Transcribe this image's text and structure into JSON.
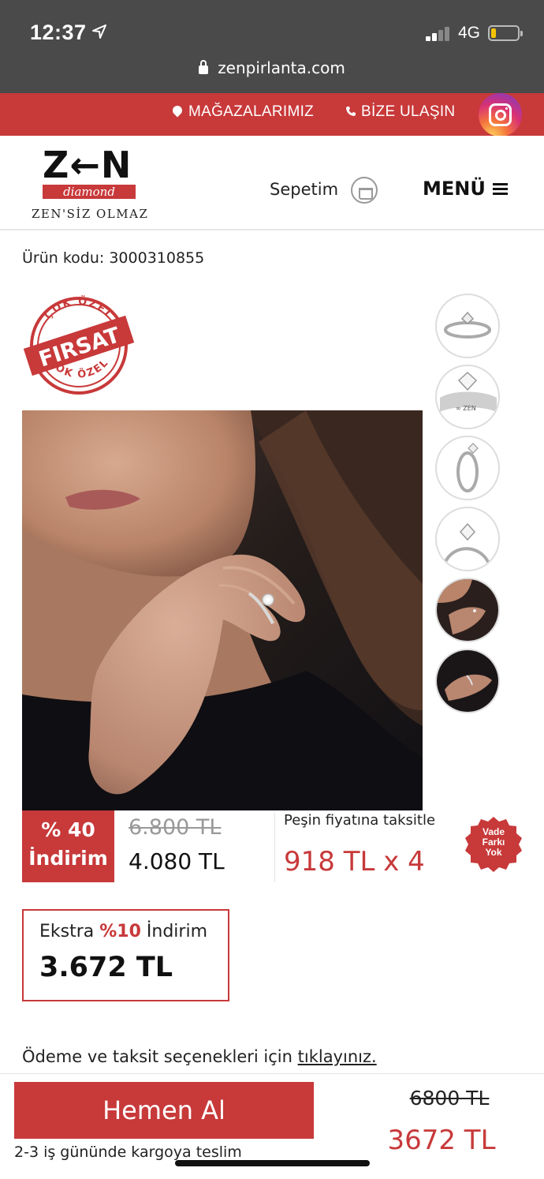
{
  "status_bar": {
    "time": "12:37",
    "network": "4G",
    "battery_level": 0.18
  },
  "browser": {
    "url": "zenpirlanta.com"
  },
  "topbar": {
    "stores_label": "MAĞAZALARIMIZ",
    "contact_label": "BİZE ULAŞIN"
  },
  "header": {
    "logo_text": "Z←N",
    "logo_sub": "diamond",
    "logo_tagline": "ZEN'SİZ OLMAZ",
    "cart_label": "Sepetim",
    "menu_label": "MENÜ"
  },
  "product": {
    "code": "Ürün kodu: 3000310855",
    "badge_top": "ÇOK ÖZEL",
    "badge_main": "FIRSAT",
    "badge_bottom": "ÇOK ÖZEL",
    "thumbnails": [
      "ring-side-view",
      "ring-closeup",
      "ring-profile",
      "ring-angle",
      "model-neck-hand",
      "model-hand"
    ]
  },
  "pricing": {
    "discount_line1": "% 40",
    "discount_line2": "İndirim",
    "old_price": "6.800 TL",
    "new_price": "4.080 TL",
    "installment_label": "Peşin fiyatına taksitle",
    "installment_value": "918 TL x 4",
    "vade_line1": "Vade",
    "vade_line2": "Farkı",
    "vade_line3": "Yok",
    "extra_prefix": "Ekstra ",
    "extra_percent": "%10",
    "extra_suffix": " İndirim",
    "extra_price": "3.672 TL",
    "payment_text": "Ödeme ve taksit seçenekleri için ",
    "payment_link": "tıklayınız."
  },
  "bottom_bar": {
    "buy_label": "Hemen Al",
    "shipping": "2-3 iş gününde kargoya teslim",
    "old_price": "6800 TL",
    "new_price": "3672 TL"
  },
  "colors": {
    "brand_red": "#c8393a",
    "status_bg": "#4a4a4a"
  }
}
